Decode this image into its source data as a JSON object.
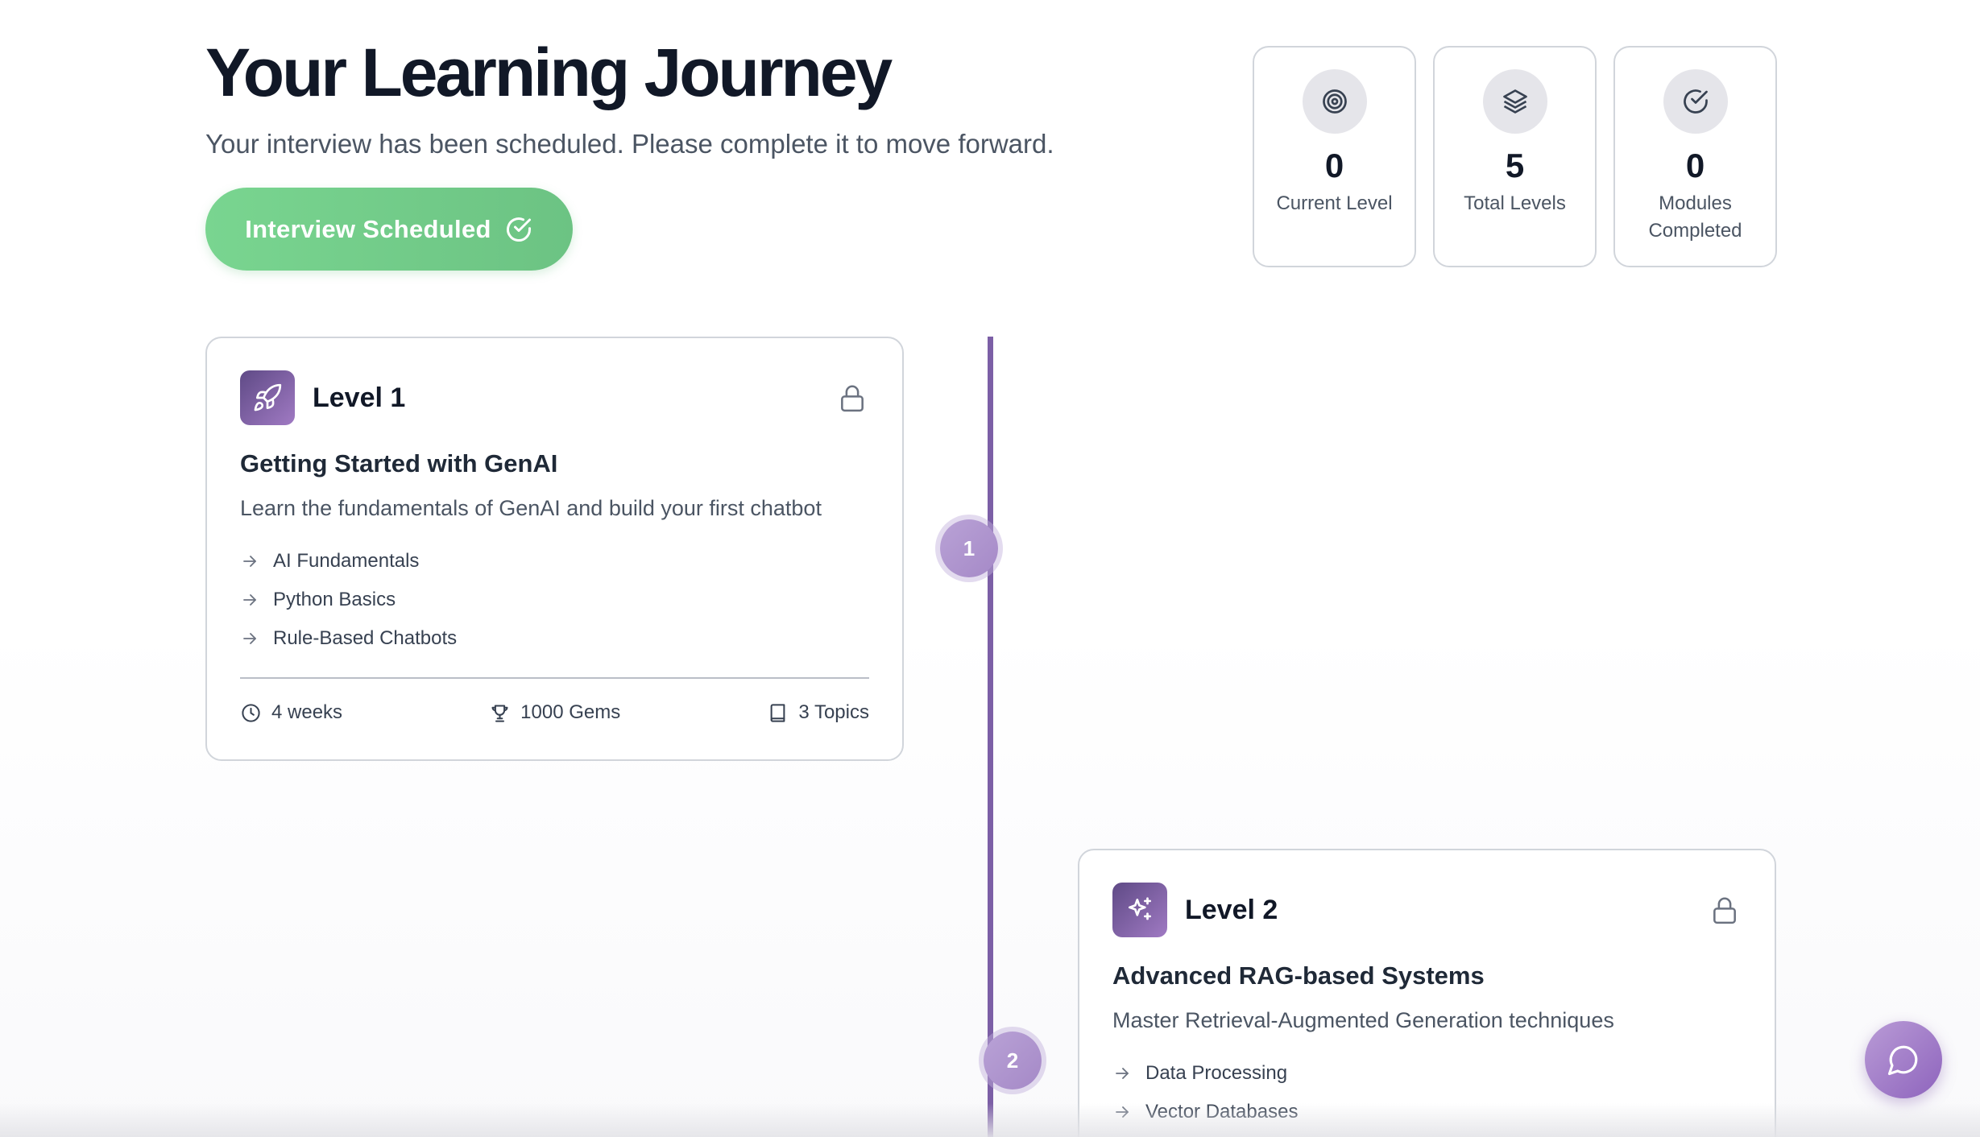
{
  "header": {
    "title": "Your Learning Journey",
    "subtitle": "Your interview has been scheduled. Please complete it to move forward.",
    "cta_label": "Interview Scheduled"
  },
  "stats": [
    {
      "value": "0",
      "label": "Current Level",
      "icon": "target-icon"
    },
    {
      "value": "5",
      "label": "Total Levels",
      "icon": "layers-icon"
    },
    {
      "value": "0",
      "label": "Modules Completed",
      "icon": "check-circle-icon"
    }
  ],
  "timeline": {
    "nodes": [
      "1",
      "2"
    ],
    "line_color": "#7c5fa6"
  },
  "levels": [
    {
      "label": "Level 1",
      "icon": "rocket-icon",
      "title": "Getting Started with GenAI",
      "description": "Learn the fundamentals of GenAI and build your first chatbot",
      "topics": [
        "AI Fundamentals",
        "Python Basics",
        "Rule-Based Chatbots"
      ],
      "duration": "4 weeks",
      "gems": "1000 Gems",
      "topic_count": "3 Topics",
      "locked": true
    },
    {
      "label": "Level 2",
      "icon": "sparkles-icon",
      "title": "Advanced RAG-based Systems",
      "description": "Master Retrieval-Augmented Generation techniques",
      "topics": [
        "Data Processing",
        "Vector Databases"
      ],
      "locked": true
    }
  ],
  "colors": {
    "accent_green": "#79d590",
    "accent_purple": "#7c5fa6"
  },
  "chat": {
    "icon": "chat-bubble-icon"
  }
}
